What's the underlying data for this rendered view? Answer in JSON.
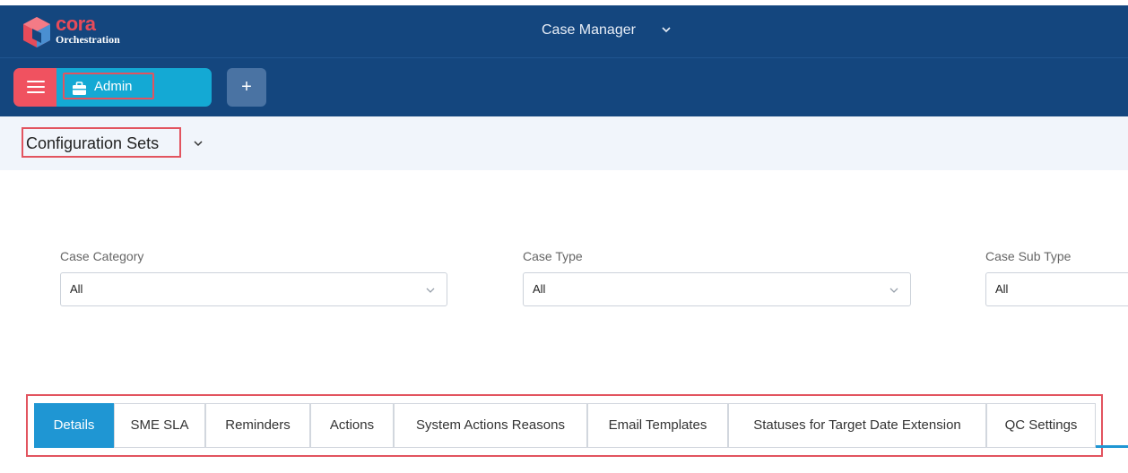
{
  "header": {
    "brand": "cora",
    "brand_sub": "Orchestration",
    "app_title": "Case Manager",
    "colors": {
      "topbar": "#14467e",
      "menu": "#f05260",
      "module": "#14a9d4",
      "highlight": "#e2545f",
      "tab_active": "#1f96d3"
    }
  },
  "navbar": {
    "menu_icon": "hamburger-icon",
    "module_icon": "briefcase-icon",
    "module_label": "Admin",
    "add_label": "+"
  },
  "config": {
    "title": "Configuration Sets"
  },
  "filters": [
    {
      "label": "Case Category",
      "value": "All"
    },
    {
      "label": "Case Type",
      "value": "All"
    },
    {
      "label": "Case Sub Type",
      "value": "All"
    }
  ],
  "tabs": [
    {
      "label": "Details",
      "active": true
    },
    {
      "label": "SME SLA"
    },
    {
      "label": "Reminders"
    },
    {
      "label": "Actions"
    },
    {
      "label": "System Actions Reasons"
    },
    {
      "label": "Email Templates"
    },
    {
      "label": "Statuses for Target Date Extension"
    },
    {
      "label": "QC Settings"
    }
  ]
}
